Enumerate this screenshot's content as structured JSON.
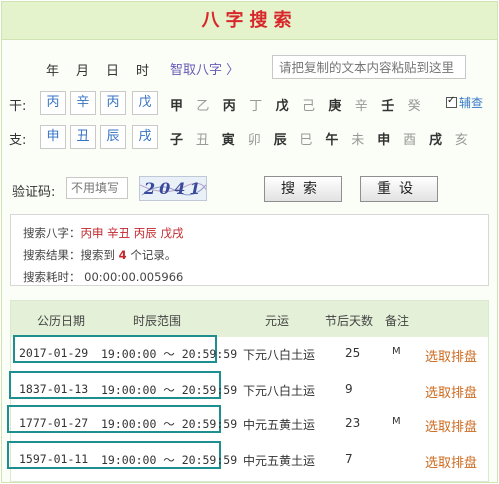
{
  "header": {
    "title": "八字搜索"
  },
  "row1": {
    "year_label": "年",
    "month_label": "月",
    "day_label": "日",
    "hour_label": "时",
    "smart_link": "智取八字",
    "paste_placeholder": "请把复制的文本内容粘贴到这里"
  },
  "gan_row": {
    "label": "干:",
    "selected": [
      "丙",
      "辛",
      "丙",
      "戊"
    ],
    "chars": [
      "甲",
      "乙",
      "丙",
      "丁",
      "戊",
      "己",
      "庚",
      "辛",
      "壬",
      "癸"
    ],
    "aux_label": "辅查",
    "aux_checked": true
  },
  "zhi_row": {
    "label": "支:",
    "selected": [
      "申",
      "丑",
      "辰",
      "戌"
    ],
    "chars": [
      "子",
      "丑",
      "寅",
      "卯",
      "辰",
      "巳",
      "午",
      "未",
      "申",
      "酉",
      "戌",
      "亥"
    ]
  },
  "verify": {
    "label": "验证码:",
    "placeholder": "不用填写",
    "captcha_text": "2041",
    "search_button": "搜索",
    "reset_button": "重设"
  },
  "result": {
    "bazi_label": "搜索八字：",
    "bazi_value": "丙申 辛丑 丙辰 戊戌",
    "count_label": "搜索结果：",
    "count_prefix": "搜索到",
    "count_value": "4",
    "count_suffix": "个记录。",
    "time_label": "搜索耗时：",
    "time_value": "00:00:00.005966"
  },
  "table": {
    "headers": [
      "公历日期",
      "时辰范围",
      "元运",
      "节后天数",
      "备注"
    ],
    "rows": [
      {
        "date": "2017-01-29",
        "range": "19:00:00 ～ 20:59:59",
        "yun": "下元八白土运",
        "days": "25",
        "note": "M",
        "action": "选取排盘"
      },
      {
        "date": "1837-01-13",
        "range": "19:00:00 ～ 20:59:59",
        "yun": "下元八白土运",
        "days": "9",
        "note": "",
        "action": "选取排盘"
      },
      {
        "date": "1777-01-27",
        "range": "19:00:00 ～ 20:59:59",
        "yun": "中元五黄土运",
        "days": "23",
        "note": "M",
        "action": "选取排盘"
      },
      {
        "date": "1597-01-11",
        "range": "19:00:00 ～ 20:59:59",
        "yun": "中元五黄土运",
        "days": "7",
        "note": "",
        "action": "选取排盘"
      }
    ]
  },
  "colors": {
    "title_red": "#d8262b",
    "header_green": "#e4f3cc",
    "highlight_teal": "#1f8e8e",
    "link_orange": "#cc6a1f",
    "select_blue": "#3573c4"
  }
}
